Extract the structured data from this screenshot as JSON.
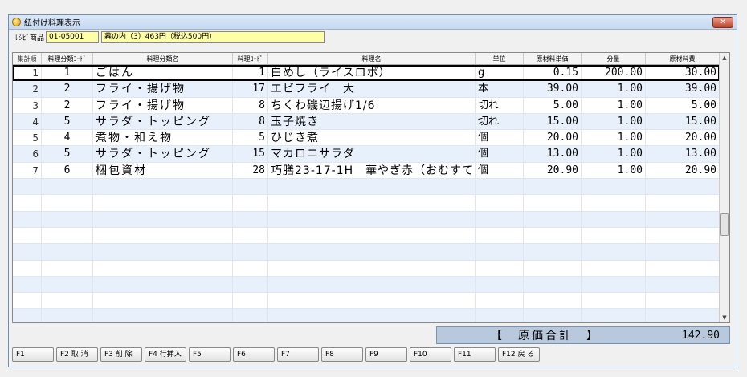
{
  "window": {
    "title": "紐付け料理表示",
    "close_label": "✕"
  },
  "info": {
    "product_label": "ﾚｼﾋﾟ商品",
    "product_code": "01-05001",
    "product_name": "幕の内（3）463円（税込500円）"
  },
  "columns": [
    "集計順",
    "料理分類ｺｰﾄﾞ",
    "料理分類名",
    "料理ｺｰﾄﾞ",
    "料理名",
    "単位",
    "原材料単価",
    "分量",
    "原材料費"
  ],
  "rows": [
    {
      "order": "1",
      "cat_code": "1",
      "cat_name": "ごはん",
      "dish_code": "1",
      "dish_name": "白めし（ライスロボ）",
      "unit": "g",
      "unit_price": "0.15",
      "qty": "200.00",
      "cost": "30.00"
    },
    {
      "order": "2",
      "cat_code": "2",
      "cat_name": "フライ・揚げ物",
      "dish_code": "17",
      "dish_name": "エビフライ　大",
      "unit": "本",
      "unit_price": "39.00",
      "qty": "1.00",
      "cost": "39.00"
    },
    {
      "order": "3",
      "cat_code": "2",
      "cat_name": "フライ・揚げ物",
      "dish_code": "8",
      "dish_name": "ちくわ磯辺揚げ1/6",
      "unit": "切れ",
      "unit_price": "5.00",
      "qty": "1.00",
      "cost": "5.00"
    },
    {
      "order": "4",
      "cat_code": "5",
      "cat_name": "サラダ・トッピング",
      "dish_code": "8",
      "dish_name": "玉子焼き",
      "unit": "切れ",
      "unit_price": "15.00",
      "qty": "1.00",
      "cost": "15.00"
    },
    {
      "order": "5",
      "cat_code": "4",
      "cat_name": "煮物・和え物",
      "dish_code": "5",
      "dish_name": "ひじき煮",
      "unit": "個",
      "unit_price": "20.00",
      "qty": "1.00",
      "cost": "20.00"
    },
    {
      "order": "6",
      "cat_code": "5",
      "cat_name": "サラダ・トッピング",
      "dish_code": "15",
      "dish_name": "マカロニサラダ",
      "unit": "個",
      "unit_price": "13.00",
      "qty": "1.00",
      "cost": "13.00"
    },
    {
      "order": "7",
      "cat_code": "6",
      "cat_name": "梱包資材",
      "dish_code": "28",
      "dish_name": "巧膳23-17-1H　華やぎ赤（おむすて",
      "unit": "個",
      "unit_price": "20.90",
      "qty": "1.00",
      "cost": "20.90"
    }
  ],
  "total": {
    "label": "【　原価合計　】",
    "value": "142.90"
  },
  "fkeys": [
    "F1",
    "F2 取 消",
    "F3 削 除",
    "F4 行挿入",
    "F5",
    "F6",
    "F7",
    "F8",
    "F9",
    "F10",
    "F11",
    "F12 戻 る"
  ],
  "icons": {
    "title": "app-icon",
    "close": "close-icon",
    "scroll_up": "scroll-up-icon",
    "scroll_down": "scroll-down-icon"
  }
}
